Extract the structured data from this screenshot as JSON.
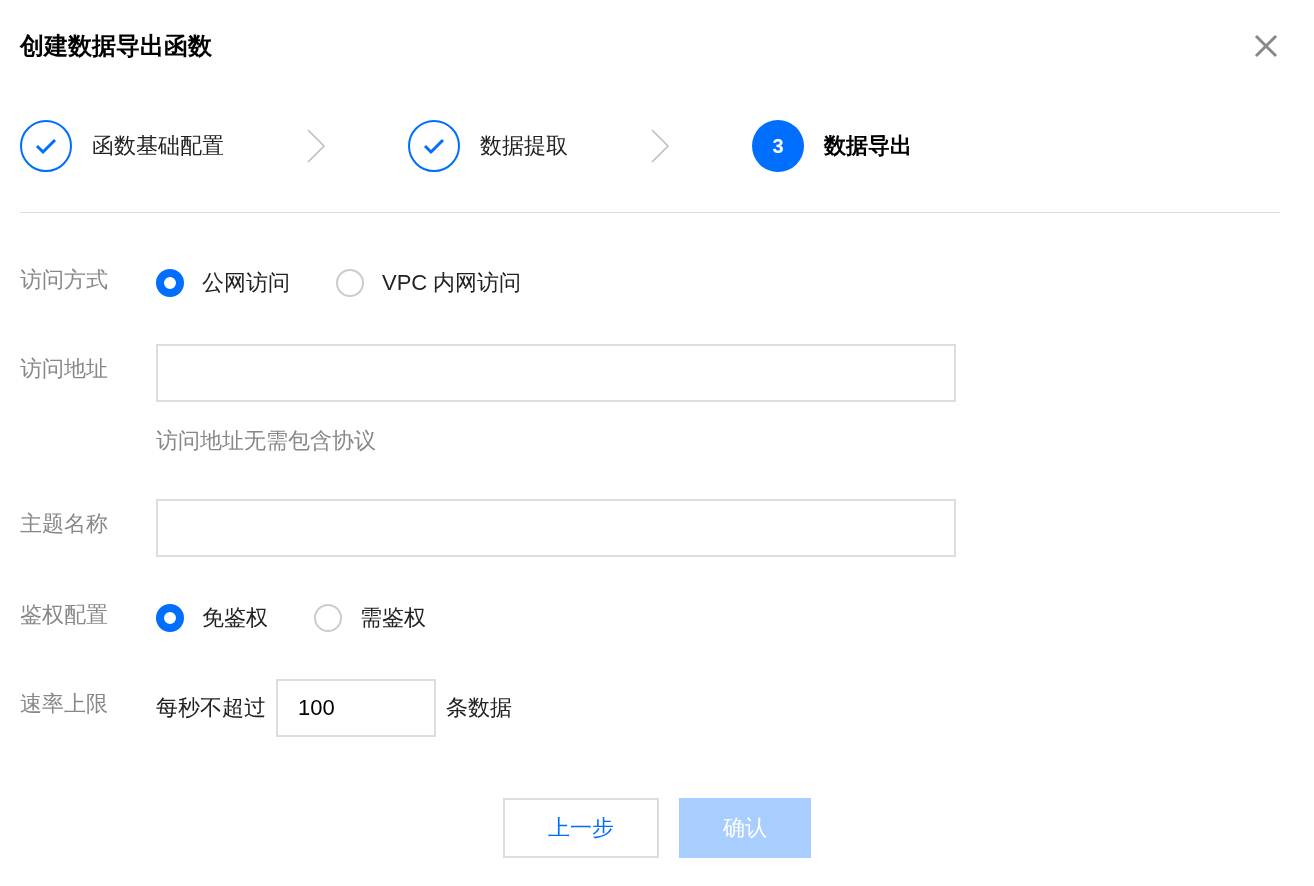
{
  "dialog": {
    "title": "创建数据导出函数"
  },
  "steps": [
    {
      "label": "函数基础配置",
      "kind": "done"
    },
    {
      "label": "数据提取",
      "kind": "done"
    },
    {
      "number": "3",
      "label": "数据导出",
      "kind": "current"
    }
  ],
  "form": [
    {
      "kind": "radio",
      "label": "访问方式",
      "options": [
        {
          "label": "公网访问",
          "selected": true
        },
        {
          "label": "VPC 内网访问",
          "selected": false
        }
      ]
    },
    {
      "kind": "text",
      "label": "访问地址",
      "help": "访问地址无需包含协议"
    },
    {
      "kind": "text",
      "label": "主题名称"
    },
    {
      "kind": "radio",
      "label": "鉴权配置",
      "options": [
        {
          "label": "免鉴权",
          "selected": true
        },
        {
          "label": "需鉴权",
          "selected": false
        }
      ]
    },
    {
      "kind": "rate",
      "label": "速率上限",
      "prefix": "每秒不超过",
      "value": "100",
      "suffix": "条数据"
    }
  ],
  "buttons": [
    {
      "label": "上一步",
      "kind": "secondary",
      "disabled": false
    },
    {
      "label": "确认",
      "kind": "primary",
      "disabled": true
    }
  ]
}
